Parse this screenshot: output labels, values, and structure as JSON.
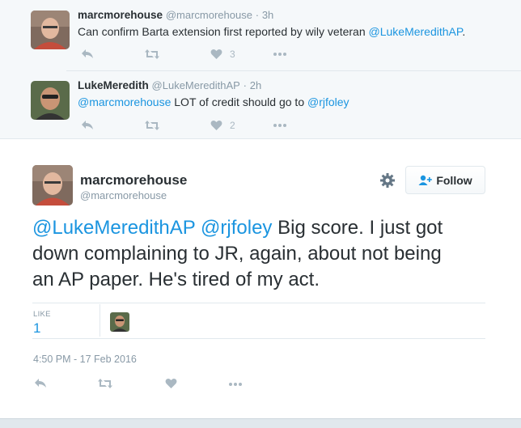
{
  "ancestors": [
    {
      "name": "marcmorehouse",
      "handle": "@marcmorehouse",
      "separator": "·",
      "time": "3h",
      "text_before": "Can confirm Barta extension first reported by wily veteran ",
      "text_mention": "@LukeMeredithAP",
      "text_after": ".",
      "likes": "3",
      "avatar_bg": "#8a6f60"
    },
    {
      "name": "LukeMeredith",
      "handle": "@LukeMeredithAP",
      "separator": "·",
      "time": "2h",
      "mention1": "@marcmorehouse",
      "middle": " LOT of credit should go to ",
      "mention2": "@rjfoley",
      "likes": "2",
      "avatar_bg": "#6b5a45"
    }
  ],
  "main_tweet": {
    "name": "marcmorehouse",
    "handle": "@marcmorehouse",
    "follow_label": "Follow",
    "mention1": "@LukeMeredithAP",
    "mention2": "@rjfoley",
    "text_line1_rest": " Big score. I just got",
    "text_line2": "down complaining to JR, again, about not being",
    "text_line3": "an AP paper. He's tired of my act.",
    "like_label": "LIKE",
    "like_count": "1",
    "timestamp": "4:50 PM - 17 Feb 2016"
  },
  "colors": {
    "link": "#1b95e0",
    "muted": "#8899a6",
    "icon": "#aab8c2",
    "text": "#292f33"
  },
  "icons": [
    "reply-icon",
    "retweet-icon",
    "heart-icon",
    "more-icon",
    "gear-icon",
    "follow-person-icon"
  ]
}
